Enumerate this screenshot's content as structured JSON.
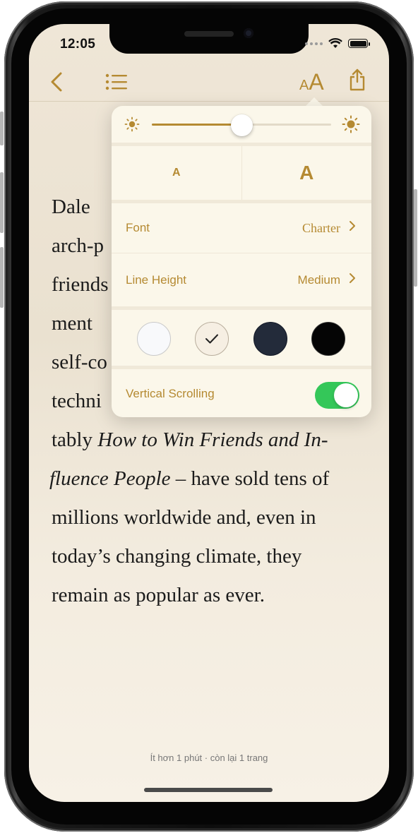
{
  "status_bar": {
    "time": "12:05"
  },
  "toolbar": {
    "back_icon": "chevron-left-icon",
    "toc_icon": "list-icon",
    "text_size_icon": "aa-icon",
    "text_size_label": "AA",
    "share_icon": "share-icon"
  },
  "reader": {
    "lines": [
      [
        "Dale",
        ""
      ],
      [
        "arch-p",
        ""
      ],
      [
        "friends",
        ""
      ],
      [
        "ment",
        ""
      ],
      [
        "self-co",
        ""
      ],
      [
        "techni",
        ""
      ]
    ],
    "line7_prefix": "tably ",
    "line7_italic": "How to Win Friends and In-",
    "line8_italic": "fluence People",
    "line8_rest": " – have sold tens of",
    "line9": "millions worldwide and, even in",
    "line10": "today’s changing climate, they",
    "line11": "remain as popular as ever."
  },
  "settings": {
    "brightness": 0.5,
    "text_smaller_label": "A",
    "text_larger_label": "A",
    "font_label": "Font",
    "font_value": "Charter",
    "line_height_label": "Line Height",
    "line_height_value": "Medium",
    "themes": [
      {
        "name": "white",
        "color": "#f8f9fb",
        "selected": false
      },
      {
        "name": "sepia",
        "color": "#f6efe3",
        "selected": true
      },
      {
        "name": "gray",
        "color": "#232b3a",
        "selected": false
      },
      {
        "name": "night",
        "color": "#050505",
        "selected": false
      }
    ],
    "vertical_scrolling_label": "Vertical Scrolling",
    "vertical_scrolling_on": true,
    "accent_color": "#b58a32",
    "toggle_color": "#34c759"
  },
  "footer": {
    "progress_text": "Ít hơn 1 phút · còn lại 1 trang"
  }
}
